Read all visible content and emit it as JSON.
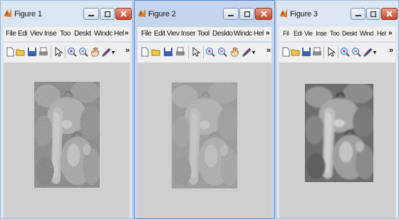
{
  "menu": [
    "File",
    "Edit",
    "View",
    "Insert",
    "Tools",
    "Desktop",
    "Window",
    "Help"
  ],
  "windows": [
    {
      "title": "Figure 1",
      "menu_visible": [
        "File",
        "Edi",
        "Viev",
        "Inse",
        "Too",
        "Deskt",
        "Windc",
        "Hel"
      ],
      "overflow": "»"
    },
    {
      "title": "Figure 2",
      "menu_visible": [
        "File",
        "Edit",
        "Viev",
        "Inser",
        "Tool",
        "Deskto",
        "Windc",
        "Hel"
      ],
      "overflow": "»"
    },
    {
      "title": "Figure 3",
      "menu_visible": [
        "Fil",
        "Edi",
        "Vie",
        "Inse",
        "Too",
        "Deskt",
        "Wind",
        "Hel"
      ],
      "overflow": "»"
    }
  ],
  "toolbar_icons": [
    "new-figure-icon",
    "open-file-icon",
    "save-icon",
    "print-icon",
    "edit-plot-arrow-icon",
    "zoom-in-icon",
    "zoom-out-icon",
    "pan-hand-icon",
    "data-cursor-brush-icon"
  ],
  "toolbar_overflow": "»",
  "colors": {
    "close_button": "#c7452a",
    "canvas_background": "#cfcfcf",
    "active_window_border": "#5a86c0"
  }
}
